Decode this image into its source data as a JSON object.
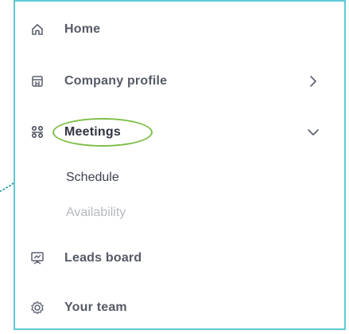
{
  "nav": {
    "items": [
      {
        "label": "Home",
        "icon": "home-icon"
      },
      {
        "label": "Company profile",
        "icon": "building-icon",
        "chevron": "chevron-right-icon"
      },
      {
        "label": "Meetings",
        "icon": "people-icon",
        "chevron": "chevron-down-icon",
        "active": true,
        "children": [
          {
            "label": "Schedule"
          },
          {
            "label": "Availability",
            "muted": true
          }
        ]
      },
      {
        "label": "Leads board",
        "icon": "chart-board-icon"
      },
      {
        "label": "Your team",
        "icon": "gear-icon"
      }
    ]
  },
  "colors": {
    "panel_border": "#5ccbd3",
    "highlight": "#7ebf4a",
    "pointer": "#1f8fa0",
    "text": "#555a66",
    "muted": "#b6b9bf"
  }
}
